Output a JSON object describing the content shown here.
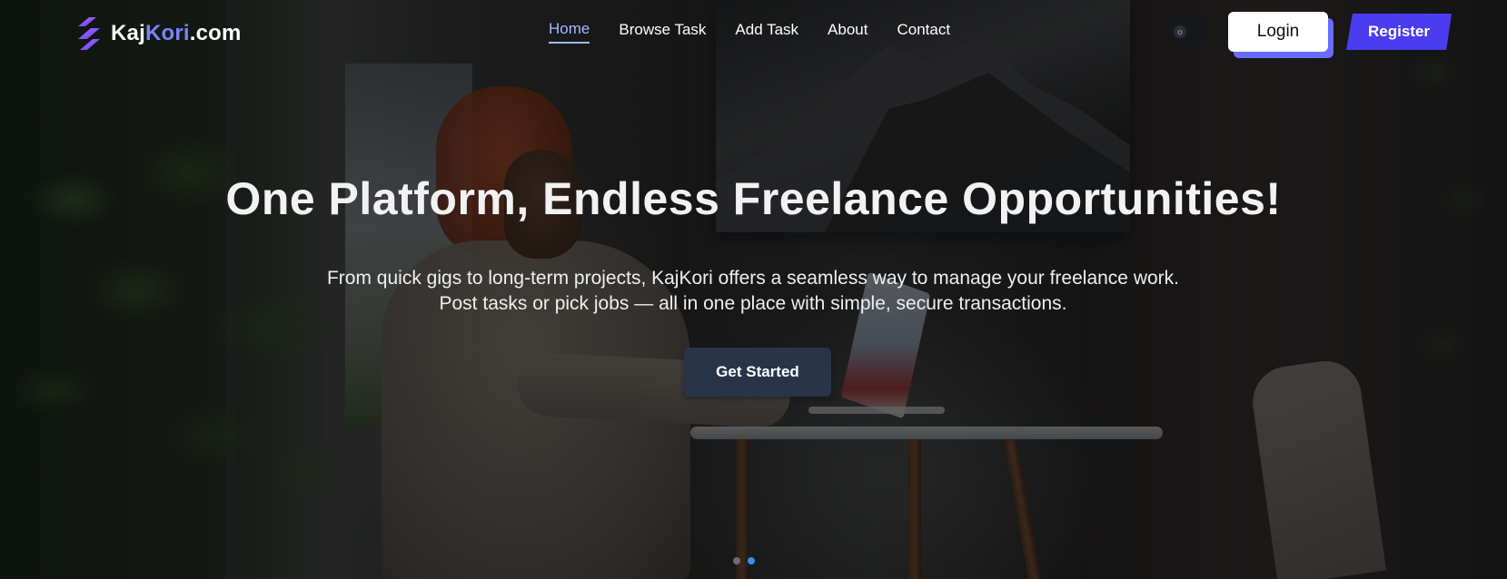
{
  "brand": {
    "name_part1": "Kaj",
    "name_part2": "Kori",
    "name_part3": ".com",
    "accent_color": "#7a84ff",
    "logo_icon": "lightning-stripes-logo-icon"
  },
  "nav": {
    "links": [
      {
        "label": "Home",
        "active": true
      },
      {
        "label": "Browse Task",
        "active": false
      },
      {
        "label": "Add Task",
        "active": false
      },
      {
        "label": "About",
        "active": false
      },
      {
        "label": "Contact",
        "active": false
      }
    ],
    "active_color": "#a8b7ff",
    "theme_toggle_icon": "sun-icon",
    "login_label": "Login",
    "register_label": "Register",
    "register_color": "#4b3cf0"
  },
  "hero": {
    "title": "One Platform, Endless Freelance Opportunities!",
    "subtitle": "From quick gigs to long-term projects, KajKori offers a seamless way to manage your freelance work. Post tasks or pick jobs — all in one place with simple, secure transactions.",
    "cta_label": "Get Started",
    "cta_color": "#2a3448",
    "slides": {
      "count": 2,
      "active_index": 1
    }
  }
}
